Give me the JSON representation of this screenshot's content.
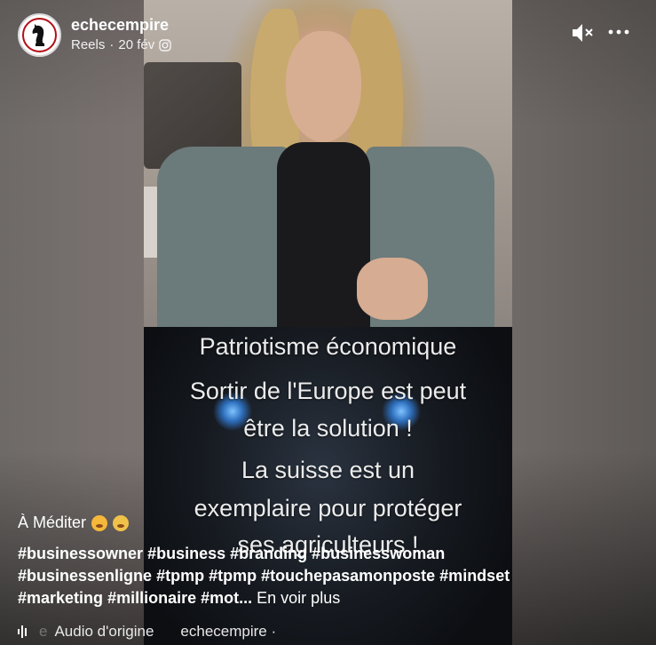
{
  "header": {
    "username": "echecempire",
    "source": "Reels",
    "separator": "·",
    "date": "20 fév",
    "platform_icon": "instagram-icon"
  },
  "controls": {
    "mute_icon": "speaker-muted-icon",
    "more_icon": "more-horizontal-icon",
    "more_label": "•••"
  },
  "video": {
    "overlay_lines": [
      "Patriotisme économique",
      "Sortir de l'Europe est peut",
      "être la solution !",
      "La suisse est un",
      "exemplaire pour protéger",
      "ses agriculteurs !"
    ]
  },
  "caption": {
    "title": "À Méditer",
    "emojis": [
      "thinking-face-emoji",
      "exploding-head-emoji"
    ],
    "hashtags": [
      "#businessowner",
      "#business",
      "#branding",
      "#businesswoman",
      "#businessenligne",
      "#tpmp",
      "#tpmp",
      "#touchepasamonposte",
      "#mindset",
      "#marketing",
      "#millionaire",
      "#mot..."
    ],
    "see_more": "En voir plus"
  },
  "audio": {
    "icon": "audio-waveform-icon",
    "fade_char": "e",
    "label": "Audio d'origine",
    "artist": "echecempire ·"
  },
  "colors": {
    "avatar_ring": "#b30f17",
    "text": "#ffffff"
  }
}
